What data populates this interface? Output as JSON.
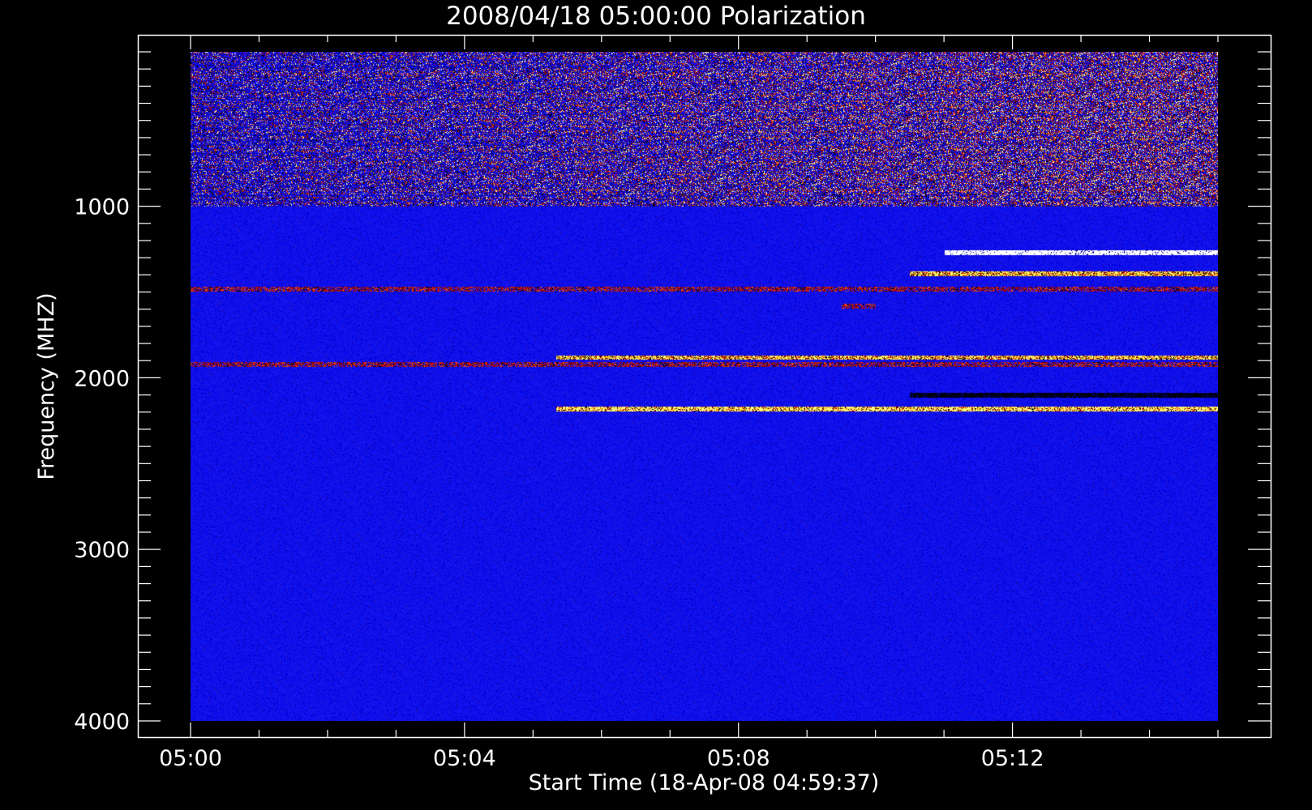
{
  "chart_data": {
    "type": "heatmap",
    "title": "2008/04/18 05:00:00 Polarization",
    "xlabel": "Start Time (18-Apr-08 04:59:37)",
    "ylabel": "Frequency (MHZ)",
    "x_range": [
      "05:00",
      "05:15"
    ],
    "y_range": [
      4000,
      100
    ],
    "y_reversed": true,
    "x_tick_labels": [
      "05:00",
      "05:04",
      "05:08",
      "05:12"
    ],
    "y_tick_labels": [
      "1000",
      "2000",
      "3000",
      "4000"
    ],
    "grid": false,
    "background_color": "#000000",
    "foreground_color": "#ffffff",
    "colormap": [
      "#000000",
      "#0000a0",
      "#1010f0",
      "#c00000",
      "#ff6000",
      "#ffc000",
      "#ffff80",
      "#ffffff"
    ],
    "features": [
      {
        "desc": "noisy interference band",
        "freq_start_mhz": 100,
        "freq_end_mhz": 1000,
        "time_start": "05:00",
        "time_end": "05:15"
      },
      {
        "desc": "white line",
        "freq_mhz": 1270,
        "time_start": "05:11",
        "time_end": "05:15"
      },
      {
        "desc": "bright line",
        "freq_mhz": 1390,
        "time_start": "05:10:30",
        "time_end": "05:15"
      },
      {
        "desc": "red line",
        "freq_mhz": 1480,
        "time_start": "05:00",
        "time_end": "05:15"
      },
      {
        "desc": "red patch",
        "freq_mhz": 1580,
        "time_start": "05:09:30",
        "time_end": "05:10"
      },
      {
        "desc": "bright band",
        "freq_mhz": 1880,
        "time_start": "05:05:20",
        "time_end": "05:15"
      },
      {
        "desc": "red band",
        "freq_mhz": 1920,
        "time_start": "05:00",
        "time_end": "05:15"
      },
      {
        "desc": "dark line",
        "freq_mhz": 2100,
        "time_start": "05:10:30",
        "time_end": "05:15"
      },
      {
        "desc": "yellow burst band",
        "freq_mhz": 2180,
        "time_start": "05:05:20",
        "time_end": "05:15"
      }
    ]
  }
}
